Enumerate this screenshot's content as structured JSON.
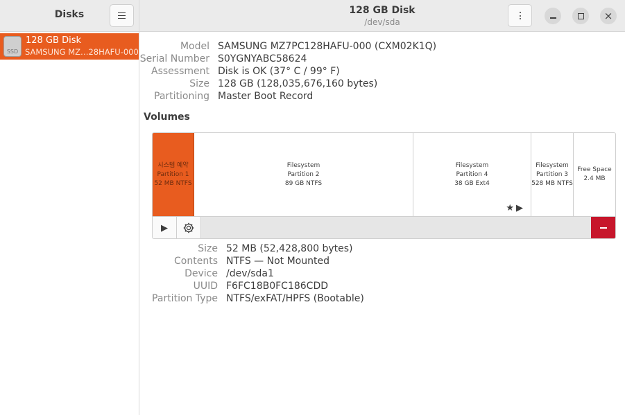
{
  "sidebar": {
    "title": "Disks",
    "disk_item": {
      "name": "128 GB Disk",
      "model": "SAMSUNG MZ…28HAFU-000",
      "icon_label": "SSD"
    }
  },
  "header": {
    "title": "128 GB Disk",
    "subtitle": "/dev/sda"
  },
  "disk_info": [
    {
      "label": "Model",
      "value": "SAMSUNG MZ7PC128HAFU-000 (CXM02K1Q)"
    },
    {
      "label": "Serial Number",
      "value": "S0YGNYABC58624"
    },
    {
      "label": "Assessment",
      "value": "Disk is OK (37° C / 99° F)"
    },
    {
      "label": "Size",
      "value": "128 GB (128,035,676,160 bytes)"
    },
    {
      "label": "Partitioning",
      "value": "Master Boot Record"
    }
  ],
  "volumes_title": "Volumes",
  "volumes": [
    {
      "line1": "시스템 예약",
      "line2": "Partition 1",
      "line3": "52 MB NTFS",
      "selected": true
    },
    {
      "line1": "Filesystem",
      "line2": "Partition 2",
      "line3": "89 GB NTFS",
      "selected": false
    },
    {
      "line1": "Filesystem",
      "line2": "Partition 4",
      "line3": "38 GB Ext4",
      "selected": false
    },
    {
      "line1": "Filesystem",
      "line2": "Partition 3",
      "line3": "528 MB NTFS",
      "selected": false
    },
    {
      "line1": "Free Space",
      "line2": "2.4 MB",
      "line3": "",
      "selected": false
    }
  ],
  "partition_info": [
    {
      "label": "Size",
      "value": "52 MB (52,428,800 bytes)"
    },
    {
      "label": "Contents",
      "value": "NTFS — Not Mounted"
    },
    {
      "label": "Device",
      "value": "/dev/sda1"
    },
    {
      "label": "UUID",
      "value": "F6FC18B0FC186CDD"
    },
    {
      "label": "Partition Type",
      "value": "NTFS/exFAT/HPFS (Bootable)"
    }
  ],
  "colors": {
    "accent": "#e85c1f",
    "danger": "#c7162b"
  },
  "icons": [
    "hamburger-menu-icon",
    "kebab-menu-icon",
    "minimize-icon",
    "maximize-icon",
    "close-icon",
    "ssd-icon",
    "star-icon",
    "play-icon",
    "gear-icon",
    "minus-icon"
  ]
}
